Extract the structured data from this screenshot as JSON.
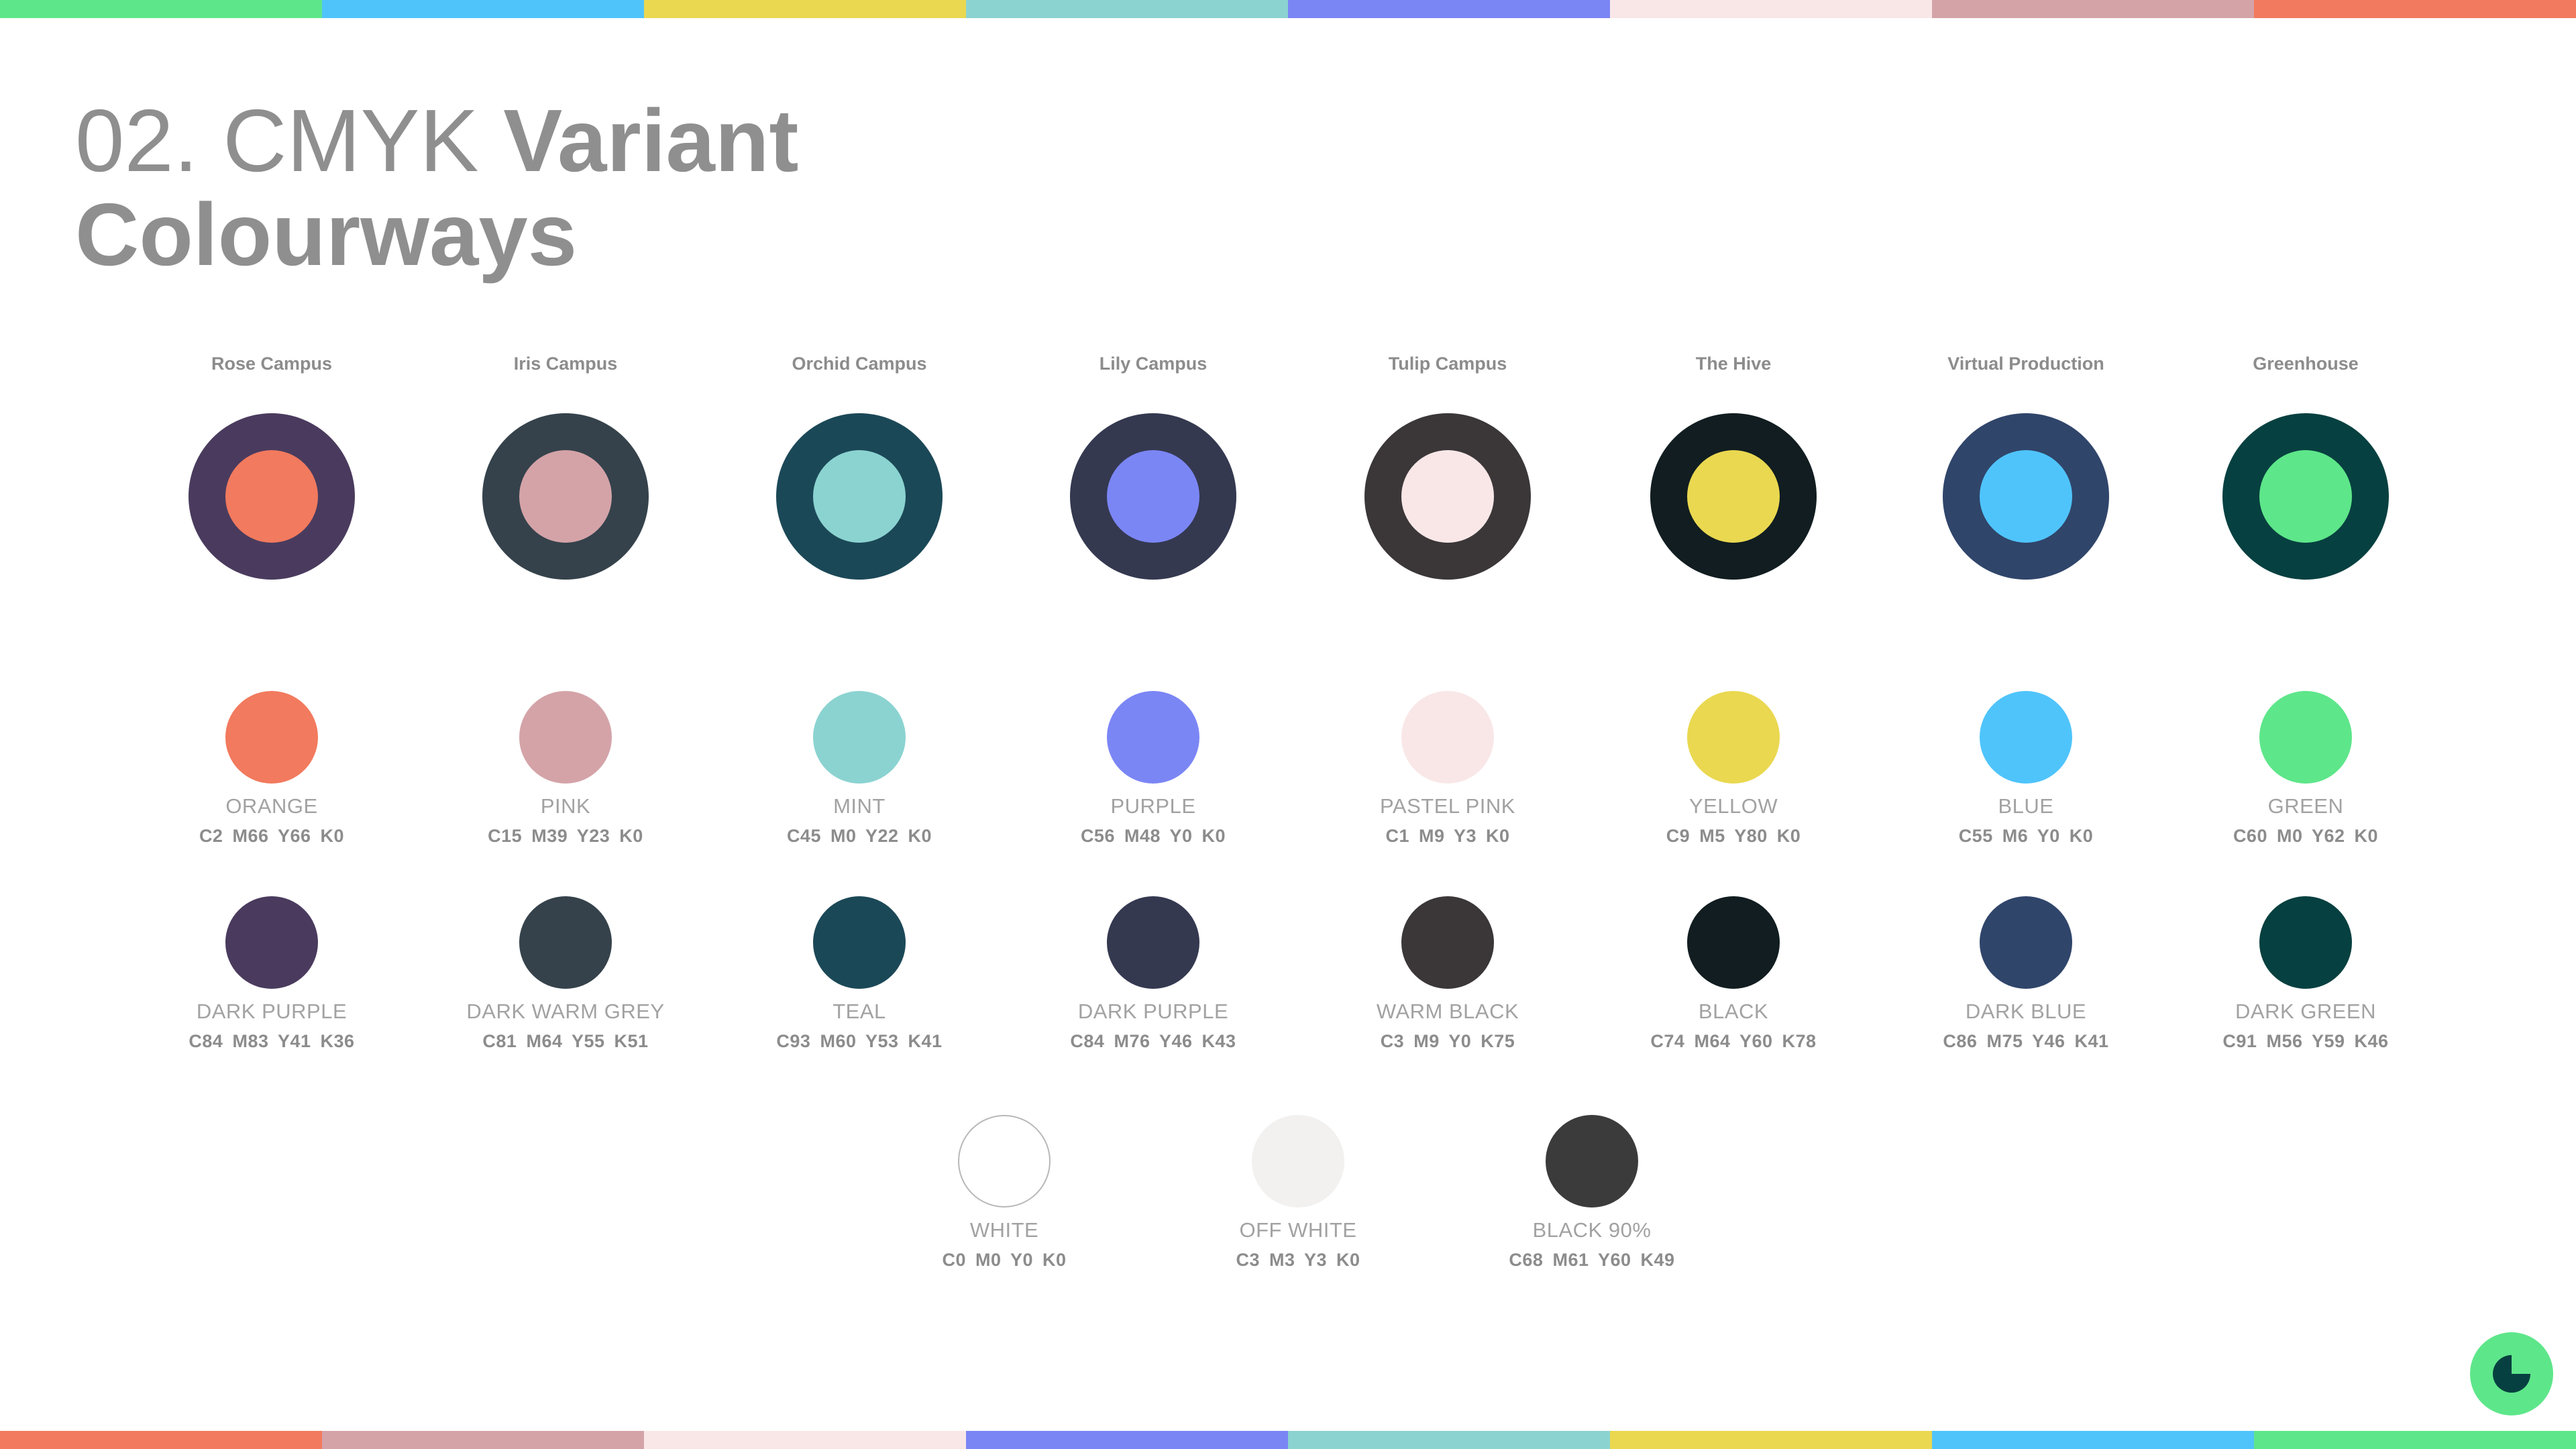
{
  "title": {
    "number": "02. CMYK",
    "bold1": "Variant",
    "bold2": "Colourways"
  },
  "stripes": {
    "top": [
      "#5ee68a",
      "#4fc4fb",
      "#ead850",
      "#8bd3d1",
      "#7b86f5",
      "#f9e7e8",
      "#d4a3a8",
      "#f27a5e"
    ],
    "bottom": [
      "#f27a5e",
      "#d4a3a8",
      "#f9e7e8",
      "#7b86f5",
      "#8bd3d1",
      "#ead850",
      "#4fc4fb",
      "#5ee68a"
    ]
  },
  "campuses": [
    {
      "name": "Rose Campus",
      "outer": "#4a3b5e",
      "inner": "#f27a5e"
    },
    {
      "name": "Iris Campus",
      "outer": "#35424b",
      "inner": "#d4a3a8"
    },
    {
      "name": "Orchid Campus",
      "outer": "#1b4857",
      "inner": "#8bd3d1"
    },
    {
      "name": "Lily Campus",
      "outer": "#343950",
      "inner": "#7b86f5"
    },
    {
      "name": "Tulip Campus",
      "outer": "#3b3739",
      "inner": "#f9e7e8"
    },
    {
      "name": "The Hive",
      "outer": "#111d20",
      "inner": "#ead850"
    },
    {
      "name": "Virtual Production",
      "outer": "#30456a",
      "inner": "#4fc4fb"
    },
    {
      "name": "Greenhouse",
      "outer": "#074040",
      "inner": "#5ee68a"
    }
  ],
  "light_swatches": [
    {
      "name": "ORANGE",
      "code": "C2 M66 Y66 K0",
      "color": "#f27a5e"
    },
    {
      "name": "PINK",
      "code": "C15 M39 Y23 K0",
      "color": "#d4a3a8"
    },
    {
      "name": "MINT",
      "code": "C45 M0 Y22 K0",
      "color": "#8bd3d1"
    },
    {
      "name": "PURPLE",
      "code": "C56 M48 Y0 K0",
      "color": "#7b86f5"
    },
    {
      "name": "PASTEL PINK",
      "code": "C1 M9 Y3 K0",
      "color": "#f9e7e8"
    },
    {
      "name": "YELLOW",
      "code": "C9 M5 Y80 K0",
      "color": "#ead850"
    },
    {
      "name": "BLUE",
      "code": "C55 M6 Y0 K0",
      "color": "#4fc4fb"
    },
    {
      "name": "GREEN",
      "code": "C60 M0 Y62 K0",
      "color": "#5ee68a"
    }
  ],
  "dark_swatches": [
    {
      "name": "DARK PURPLE",
      "code": "C84 M83 Y41 K36",
      "color": "#4a3b5e"
    },
    {
      "name": "DARK WARM GREY",
      "code": "C81 M64 Y55 K51",
      "color": "#35424b"
    },
    {
      "name": "TEAL",
      "code": "C93 M60 Y53 K41",
      "color": "#1b4857"
    },
    {
      "name": "DARK PURPLE",
      "code": "C84 M76 Y46 K43",
      "color": "#343950"
    },
    {
      "name": "WARM BLACK",
      "code": "C3 M9 Y0 K75",
      "color": "#3b3739"
    },
    {
      "name": "BLACK",
      "code": "C74 M64 Y60 K78",
      "color": "#111d20"
    },
    {
      "name": "DARK BLUE",
      "code": "C86 M75 Y46 K41",
      "color": "#30456a"
    },
    {
      "name": "DARK GREEN",
      "code": "C91 M56 Y59 K46",
      "color": "#074040"
    }
  ],
  "neutral_swatches": [
    {
      "name": "WHITE",
      "code": "C0 M0 Y0 K0",
      "color": "#ffffff",
      "outlined": true
    },
    {
      "name": "OFF WHITE",
      "code": "C3 M3 Y3 K0",
      "color": "#f2f1f0",
      "outlined": false
    },
    {
      "name": "BLACK 90%",
      "code": "C68 M61 Y60 K49",
      "color": "#3b3b3b",
      "outlined": false
    }
  ],
  "logo": {
    "icon": "brand-logo-icon",
    "bg": "#5ee68a",
    "fg": "#074040"
  }
}
